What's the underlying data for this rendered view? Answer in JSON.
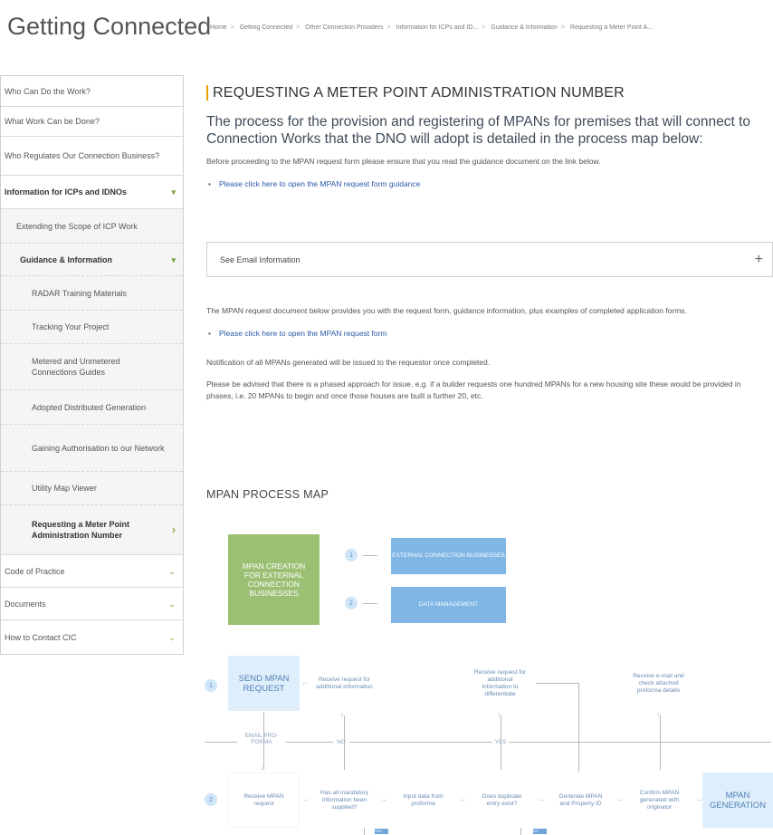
{
  "header": {
    "site_title": "Getting Connected",
    "breadcrumbs": [
      "Home",
      "Getting Connected",
      "Other Connection Providers",
      "Information for ICPs and ID...",
      "Guidance & Information",
      "Requesting a Meter Point A..."
    ]
  },
  "sidebar": {
    "items": [
      {
        "label": "Who Can Do the Work?"
      },
      {
        "label": "What Work Can be Done?"
      },
      {
        "label": "Who Regulates Our Connection Business?"
      },
      {
        "label": "Information for ICPs and IDNOs"
      },
      {
        "label": "Extending the Scope of ICP Work"
      },
      {
        "label": "Guidance & Information"
      },
      {
        "label": "RADAR Training Materials"
      },
      {
        "label": "Tracking Your Project"
      },
      {
        "label": "Metered and Unmetered Connections Guides"
      },
      {
        "label": "Adopted Distributed Generation"
      },
      {
        "label": "Gaining Authorisation to our Network"
      },
      {
        "label": "Utility Map Viewer"
      },
      {
        "label": "Requesting a Meter Point Administration Number"
      },
      {
        "label": "Code of Practice"
      },
      {
        "label": "Documents"
      },
      {
        "label": "How to Contact CIC"
      }
    ],
    "chevron_down": "▾",
    "chevron_soft": "⌄",
    "chevron_right": "›"
  },
  "main": {
    "title": "REQUESTING A METER POINT ADMINISTRATION NUMBER",
    "lead": "The process for the provision and registering of MPANs for premises that will connect to Connection Works that the DNO will adopt is detailed in the process map below:",
    "intro": "Before proceeding to the MPAN request form please ensure that you read the guidance document on the link below.",
    "link_guidance": "Please click here to open the MPAN request form guidance",
    "accordion_label": "See Email Information",
    "accordion_icon": "+",
    "doc_text": "The MPAN request document below provides you with the request form, guidance information, plus examples of completed application forms.",
    "link_form": "Please click here to open the MPAN request form",
    "notification": "Notification of all MPANs generated will be issued to the requestor once completed.",
    "advice": "Please be advised that there is a phased approach for issue, e.g. if a builder requests one hundred MPANs for a new housing site these would be provided in phases, i.e. 20 MPANs to begin and once those houses are built a further 20, etc.",
    "process_heading": "MPAN PROCESS MAP"
  },
  "process_map": {
    "creation": "MPAN CREATION FOR EXTERNAL CONNECTION BUSINESSES",
    "legend1_num": "1",
    "legend1": "EXTERNAL CONNECTION BUSINESSES",
    "legend2_num": "2",
    "legend2": "DATA MANAGEMENT",
    "row1_num": "1",
    "row2_num": "2",
    "send": "SEND MPAN REQUEST",
    "recv_more": "Receive request for additional information",
    "recv_diff": "Receive request for additional information to differentiate",
    "recv_email": "Receive e-mail and check attached proforma details",
    "email_label": "EMAIL PRO-FORMA",
    "no_label": "NO",
    "yes_label": "YES",
    "recv_mpan": "Receive MPAN request",
    "mandatory": "Has all mandatory information been supplied?",
    "input": "Input data from proforma",
    "duplicate": "Does duplicate entry exist?",
    "generate": "Generate MPAN and Property ID",
    "confirm": "Confirm MPAN generated with originator",
    "generation": "MPAN GENERATION",
    "tag_yes": "YES",
    "tag_no": "NO"
  }
}
